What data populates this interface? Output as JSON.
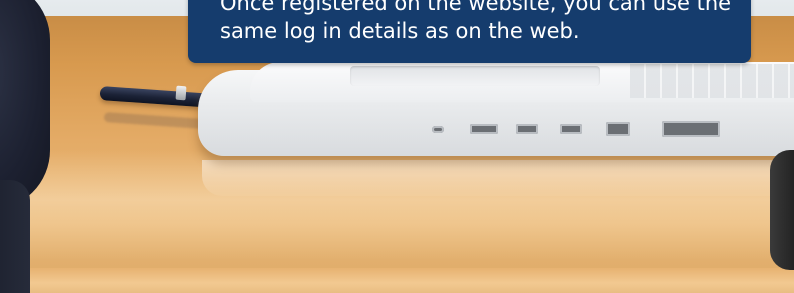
{
  "caption": {
    "line1": "Once registered on the website, you can use the",
    "line2": "same log in details as on the web."
  },
  "colors": {
    "caption_background": "#153c6d",
    "caption_text": "#ffffff",
    "desk": "#e4ab66"
  },
  "icons": {
    "pen": "pen-icon",
    "laptop": "laptop-image"
  }
}
